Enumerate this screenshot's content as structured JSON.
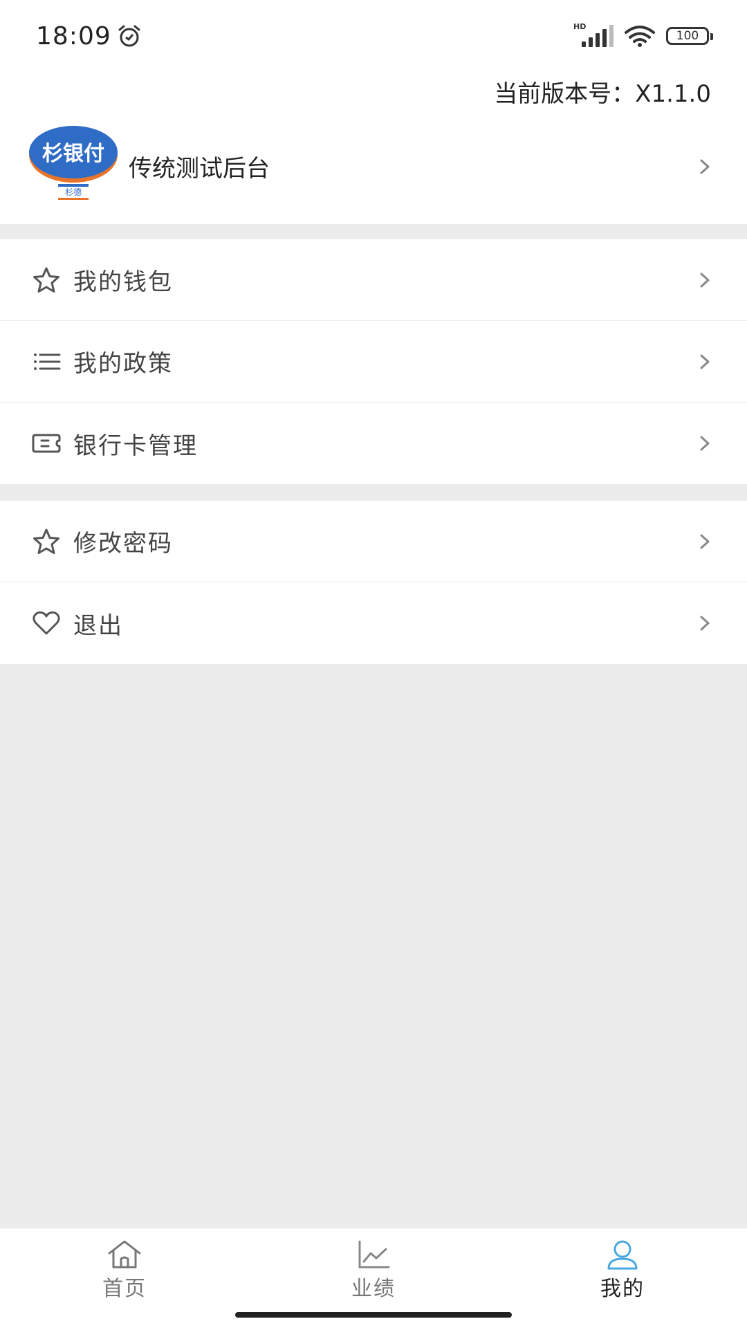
{
  "status_bar": {
    "time": "18:09",
    "hd_label": "HD",
    "battery_level": "100",
    "icons": [
      "alarm-icon",
      "signal-icon",
      "wifi-icon",
      "battery-icon"
    ]
  },
  "header": {
    "version_text": "当前版本号：X1.1.0",
    "logo_text": "杉银付",
    "logo_subtext": "杉德",
    "profile_name": "传统测试后台"
  },
  "menu_group_1": [
    {
      "label": "我的钱包",
      "icon": "star-icon"
    },
    {
      "label": "我的政策",
      "icon": "list-icon"
    },
    {
      "label": "银行卡管理",
      "icon": "ticket-icon"
    }
  ],
  "menu_group_2": [
    {
      "label": "修改密码",
      "icon": "star-icon"
    },
    {
      "label": "退出",
      "icon": "heart-icon"
    }
  ],
  "bottom_nav": {
    "tabs": [
      {
        "label": "首页",
        "icon": "home-icon",
        "active": false
      },
      {
        "label": "业绩",
        "icon": "chart-icon",
        "active": false
      },
      {
        "label": "我的",
        "icon": "user-icon",
        "active": true
      }
    ]
  },
  "colors": {
    "accent": "#4aa8e0",
    "background": "#ececec",
    "logo_blue": "#2f6cc6",
    "logo_orange": "#e8742a"
  }
}
